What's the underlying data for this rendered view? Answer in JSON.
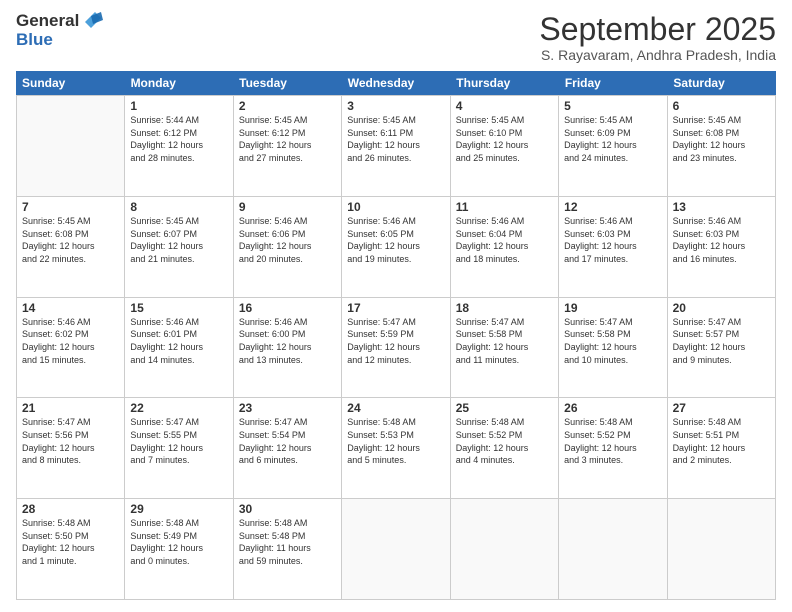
{
  "header": {
    "logo_line1": "General",
    "logo_line2": "Blue",
    "month": "September 2025",
    "location": "S. Rayavaram, Andhra Pradesh, India"
  },
  "days_of_week": [
    "Sunday",
    "Monday",
    "Tuesday",
    "Wednesday",
    "Thursday",
    "Friday",
    "Saturday"
  ],
  "weeks": [
    [
      {
        "day": "",
        "info": ""
      },
      {
        "day": "1",
        "info": "Sunrise: 5:44 AM\nSunset: 6:12 PM\nDaylight: 12 hours\nand 28 minutes."
      },
      {
        "day": "2",
        "info": "Sunrise: 5:45 AM\nSunset: 6:12 PM\nDaylight: 12 hours\nand 27 minutes."
      },
      {
        "day": "3",
        "info": "Sunrise: 5:45 AM\nSunset: 6:11 PM\nDaylight: 12 hours\nand 26 minutes."
      },
      {
        "day": "4",
        "info": "Sunrise: 5:45 AM\nSunset: 6:10 PM\nDaylight: 12 hours\nand 25 minutes."
      },
      {
        "day": "5",
        "info": "Sunrise: 5:45 AM\nSunset: 6:09 PM\nDaylight: 12 hours\nand 24 minutes."
      },
      {
        "day": "6",
        "info": "Sunrise: 5:45 AM\nSunset: 6:08 PM\nDaylight: 12 hours\nand 23 minutes."
      }
    ],
    [
      {
        "day": "7",
        "info": "Sunrise: 5:45 AM\nSunset: 6:08 PM\nDaylight: 12 hours\nand 22 minutes."
      },
      {
        "day": "8",
        "info": "Sunrise: 5:45 AM\nSunset: 6:07 PM\nDaylight: 12 hours\nand 21 minutes."
      },
      {
        "day": "9",
        "info": "Sunrise: 5:46 AM\nSunset: 6:06 PM\nDaylight: 12 hours\nand 20 minutes."
      },
      {
        "day": "10",
        "info": "Sunrise: 5:46 AM\nSunset: 6:05 PM\nDaylight: 12 hours\nand 19 minutes."
      },
      {
        "day": "11",
        "info": "Sunrise: 5:46 AM\nSunset: 6:04 PM\nDaylight: 12 hours\nand 18 minutes."
      },
      {
        "day": "12",
        "info": "Sunrise: 5:46 AM\nSunset: 6:03 PM\nDaylight: 12 hours\nand 17 minutes."
      },
      {
        "day": "13",
        "info": "Sunrise: 5:46 AM\nSunset: 6:03 PM\nDaylight: 12 hours\nand 16 minutes."
      }
    ],
    [
      {
        "day": "14",
        "info": "Sunrise: 5:46 AM\nSunset: 6:02 PM\nDaylight: 12 hours\nand 15 minutes."
      },
      {
        "day": "15",
        "info": "Sunrise: 5:46 AM\nSunset: 6:01 PM\nDaylight: 12 hours\nand 14 minutes."
      },
      {
        "day": "16",
        "info": "Sunrise: 5:46 AM\nSunset: 6:00 PM\nDaylight: 12 hours\nand 13 minutes."
      },
      {
        "day": "17",
        "info": "Sunrise: 5:47 AM\nSunset: 5:59 PM\nDaylight: 12 hours\nand 12 minutes."
      },
      {
        "day": "18",
        "info": "Sunrise: 5:47 AM\nSunset: 5:58 PM\nDaylight: 12 hours\nand 11 minutes."
      },
      {
        "day": "19",
        "info": "Sunrise: 5:47 AM\nSunset: 5:58 PM\nDaylight: 12 hours\nand 10 minutes."
      },
      {
        "day": "20",
        "info": "Sunrise: 5:47 AM\nSunset: 5:57 PM\nDaylight: 12 hours\nand 9 minutes."
      }
    ],
    [
      {
        "day": "21",
        "info": "Sunrise: 5:47 AM\nSunset: 5:56 PM\nDaylight: 12 hours\nand 8 minutes."
      },
      {
        "day": "22",
        "info": "Sunrise: 5:47 AM\nSunset: 5:55 PM\nDaylight: 12 hours\nand 7 minutes."
      },
      {
        "day": "23",
        "info": "Sunrise: 5:47 AM\nSunset: 5:54 PM\nDaylight: 12 hours\nand 6 minutes."
      },
      {
        "day": "24",
        "info": "Sunrise: 5:48 AM\nSunset: 5:53 PM\nDaylight: 12 hours\nand 5 minutes."
      },
      {
        "day": "25",
        "info": "Sunrise: 5:48 AM\nSunset: 5:52 PM\nDaylight: 12 hours\nand 4 minutes."
      },
      {
        "day": "26",
        "info": "Sunrise: 5:48 AM\nSunset: 5:52 PM\nDaylight: 12 hours\nand 3 minutes."
      },
      {
        "day": "27",
        "info": "Sunrise: 5:48 AM\nSunset: 5:51 PM\nDaylight: 12 hours\nand 2 minutes."
      }
    ],
    [
      {
        "day": "28",
        "info": "Sunrise: 5:48 AM\nSunset: 5:50 PM\nDaylight: 12 hours\nand 1 minute."
      },
      {
        "day": "29",
        "info": "Sunrise: 5:48 AM\nSunset: 5:49 PM\nDaylight: 12 hours\nand 0 minutes."
      },
      {
        "day": "30",
        "info": "Sunrise: 5:48 AM\nSunset: 5:48 PM\nDaylight: 11 hours\nand 59 minutes."
      },
      {
        "day": "",
        "info": ""
      },
      {
        "day": "",
        "info": ""
      },
      {
        "day": "",
        "info": ""
      },
      {
        "day": "",
        "info": ""
      }
    ]
  ]
}
